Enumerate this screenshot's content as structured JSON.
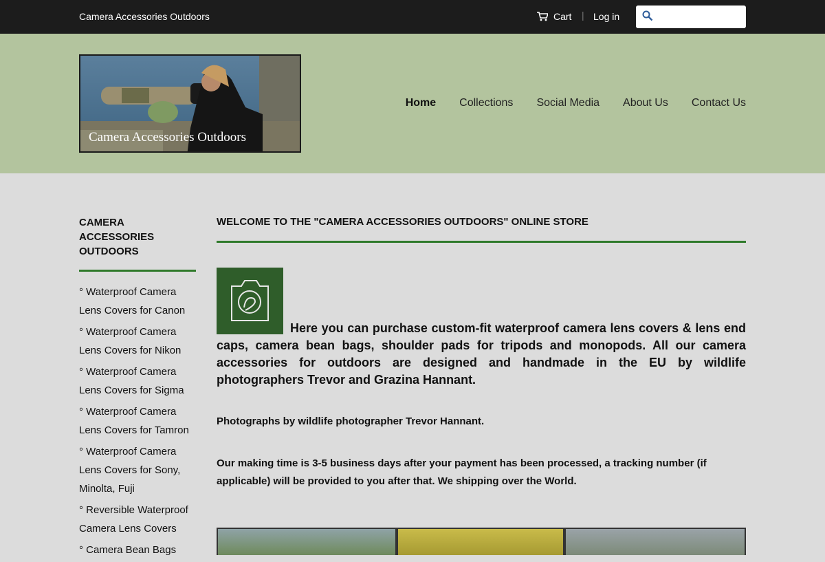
{
  "topbar": {
    "store_name": "Camera Accessories Outdoors",
    "cart_label": "Cart",
    "separator": "|",
    "login_label": "Log in",
    "search_placeholder": ""
  },
  "header": {
    "logo_text": "Camera Accessories Outdoors",
    "nav": [
      {
        "label": "Home"
      },
      {
        "label": "Collections"
      },
      {
        "label": "Social Media"
      },
      {
        "label": "About Us"
      },
      {
        "label": "Contact Us"
      }
    ]
  },
  "sidebar": {
    "title": "CAMERA ACCESSORIES OUTDOORS",
    "items": [
      {
        "label": "° Waterproof Camera Lens Covers for Canon"
      },
      {
        "label": "° Waterproof Camera Lens Covers for Nikon"
      },
      {
        "label": "° Waterproof Camera Lens Covers for Sigma"
      },
      {
        "label": "° Waterproof Camera Lens Covers for Tamron"
      },
      {
        "label": "° Waterproof Camera Lens Covers for Sony, Minolta, Fuji"
      },
      {
        "label": "° Reversible Waterproof Camera Lens Covers"
      },
      {
        "label": "° Camera Bean Bags"
      }
    ]
  },
  "main": {
    "title": "WELCOME TO THE \"CAMERA ACCESSORIES OUTDOORS\" ONLINE STORE",
    "intro": "Here you can purchase custom-fit waterproof camera lens  covers  & lens end caps, camera bean bags, shoulder pads for tripods and monopods. All our camera accessories for outdoors are designed  and handmade in the EU by wildlife photographers Trevor and Grazina Hannant.",
    "credit": "Photographs by wildlife photographer Trevor Hannant.",
    "shipping": "Our making time is 3-5 business days after your payment has been processed, a tracking number (if applicable) will be provided to you after that. We shipping over the World."
  },
  "colors": {
    "topbar_bg": "#1c1c1c",
    "header_bg": "#b3c49e",
    "page_bg": "#dcdcdc",
    "accent_green": "#2f7a2b",
    "logo_green": "#2f5d2a"
  }
}
